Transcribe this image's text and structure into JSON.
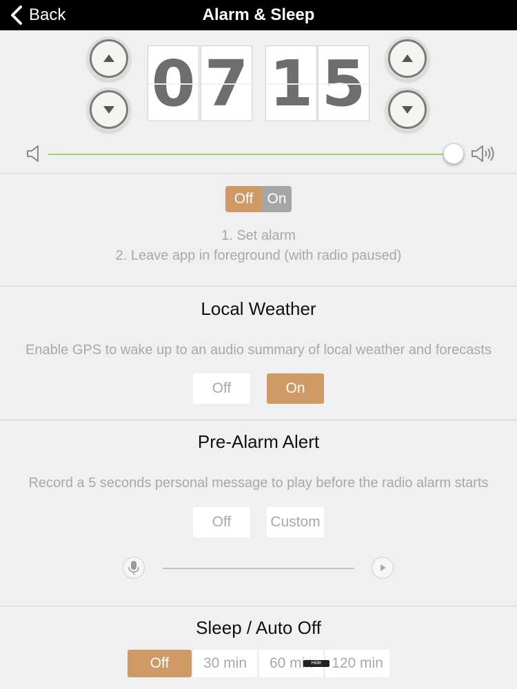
{
  "navbar": {
    "back_label": "Back",
    "title": "Alarm & Sleep"
  },
  "alarm_time": {
    "digits": [
      "0",
      "7",
      "1",
      "5"
    ]
  },
  "volume": {
    "level": 1.0
  },
  "alarm_toggle": {
    "off_label": "Off",
    "on_label": "On",
    "selected": "Off"
  },
  "instructions": {
    "line1": "1. Set alarm",
    "line2": "2. Leave app in foreground (with radio paused)"
  },
  "local_weather": {
    "title": "Local Weather",
    "description": "Enable GPS to wake up to an audio summary of local weather and forecasts",
    "options": [
      "Off",
      "On"
    ],
    "selected": "On"
  },
  "pre_alarm": {
    "title": "Pre-Alarm Alert",
    "description": "Record a 5 seconds personal message to play before the radio alarm starts",
    "options": [
      "Off",
      "Custom"
    ],
    "selected": "none"
  },
  "sleep": {
    "title": "Sleep / Auto Off",
    "options": [
      "Off",
      "30 min",
      "60 min",
      "120 min"
    ],
    "selected": "Off"
  },
  "tooltip": {
    "hide_label": "Hide"
  },
  "colors": {
    "accent": "#cf9a65",
    "slider": "#9bd46a",
    "navbar": "#000000"
  },
  "icons": [
    "chevron-left-icon",
    "arrow-up-icon",
    "arrow-down-icon",
    "speaker-low-icon",
    "speaker-high-icon",
    "microphone-icon",
    "play-icon"
  ]
}
